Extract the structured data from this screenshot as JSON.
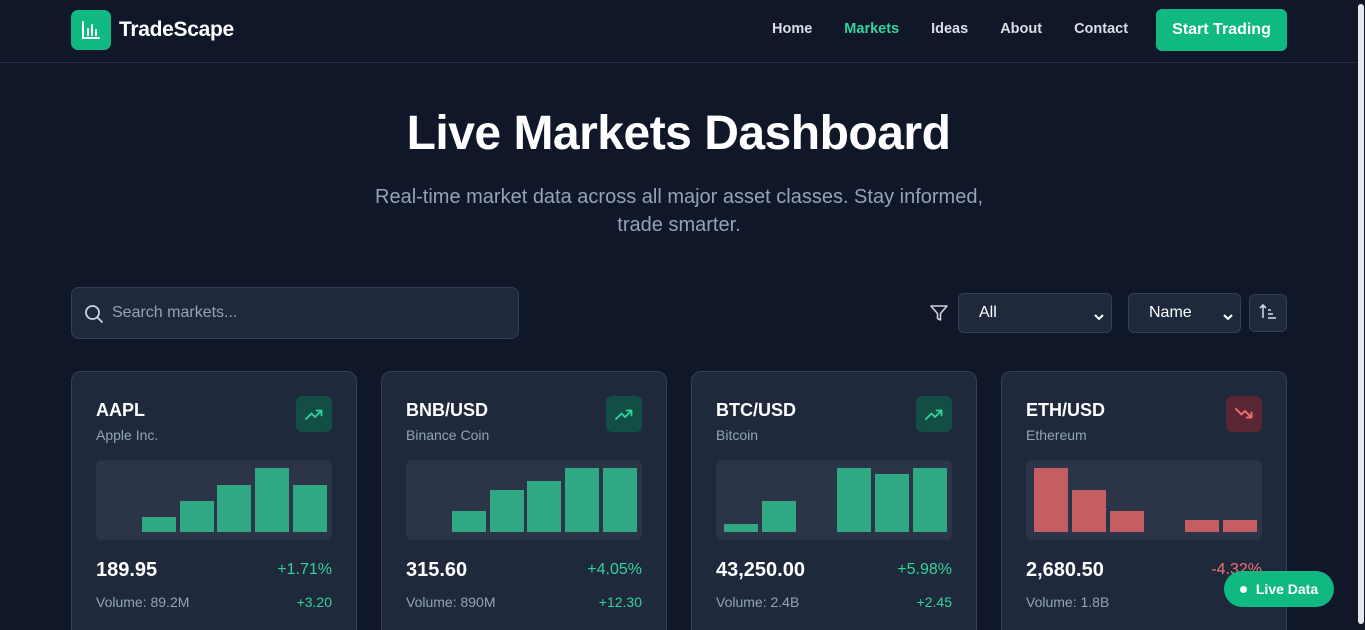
{
  "brand": {
    "name": "TradeScape",
    "icon": "bar-chart-icon",
    "color": "#10b981"
  },
  "nav": {
    "items": [
      {
        "label": "Home",
        "active": false
      },
      {
        "label": "Markets",
        "active": true
      },
      {
        "label": "Ideas",
        "active": false
      },
      {
        "label": "About",
        "active": false
      },
      {
        "label": "Contact",
        "active": false
      }
    ],
    "cta_label": "Start Trading"
  },
  "hero": {
    "title": "Live Markets Dashboard",
    "subtitle_line1": "Real-time market data across all major asset classes. Stay informed,",
    "subtitle_line2": "trade smarter."
  },
  "controls": {
    "search_placeholder": "Search markets...",
    "filter_icon": "filter-icon",
    "category_selected": "All",
    "sort_selected": "Name",
    "sort_direction_icon": "sort-ascending-icon"
  },
  "colors": {
    "up": "#34d399",
    "down": "#f87171",
    "up_bar": "#2ea983",
    "down_bar": "#c45e62"
  },
  "cards": [
    {
      "symbol": "AAPL",
      "name": "Apple Inc.",
      "trend": "up",
      "price": "189.95",
      "change_pct": "+1.71%",
      "volume": "Volume: 89.2M",
      "change_abs": "+3.20",
      "bars": [
        0.23,
        0.48,
        0.73,
        1.0,
        0.73
      ]
    },
    {
      "symbol": "BNB/USD",
      "name": "Binance Coin",
      "trend": "up",
      "price": "315.60",
      "change_pct": "+4.05%",
      "volume": "Volume: 890M",
      "change_abs": "+12.30",
      "bars": [
        0.33,
        0.66,
        0.8,
        1.0,
        1.0
      ]
    },
    {
      "symbol": "BTC/USD",
      "name": "Bitcoin",
      "trend": "up",
      "price": "43,250.00",
      "change_pct": "+5.98%",
      "volume": "Volume: 2.4B",
      "change_abs": "+2.45",
      "bars": [
        0.13,
        0.48,
        0.0,
        1.0,
        0.91,
        1.0
      ]
    },
    {
      "symbol": "ETH/USD",
      "name": "Ethereum",
      "trend": "down",
      "price": "2,680.50",
      "change_pct": "-4.32%",
      "volume": "Volume: 1.8B",
      "change_abs": "",
      "bars": [
        1.0,
        0.66,
        0.33,
        0.0,
        0.19,
        0.19
      ]
    }
  ],
  "live_badge": "Live Data"
}
